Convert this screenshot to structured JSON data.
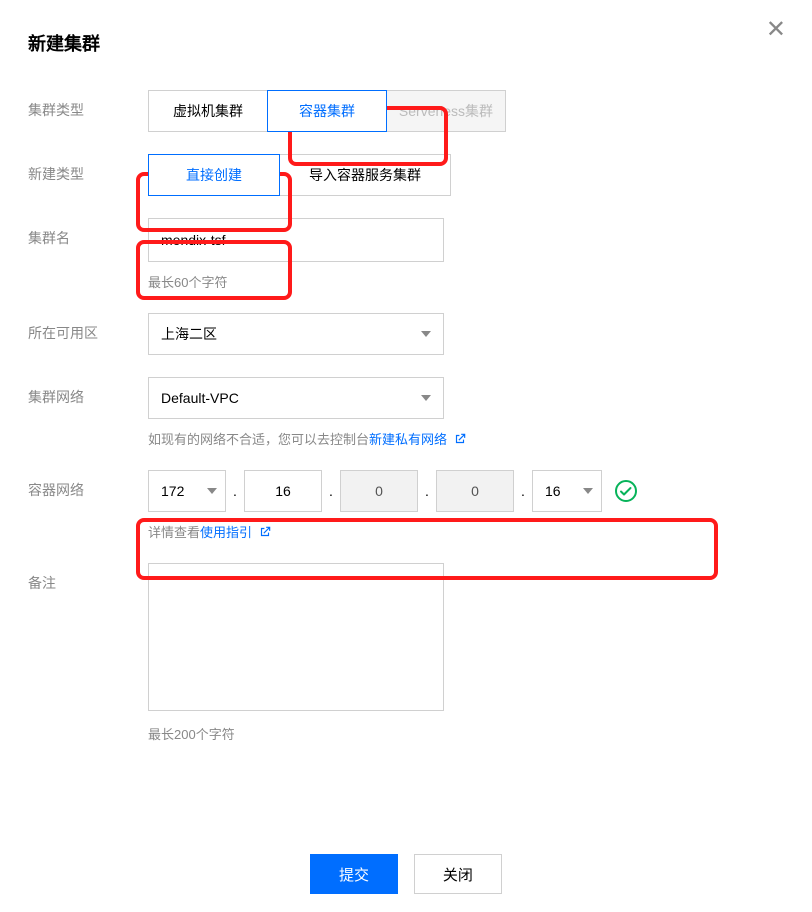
{
  "dialog": {
    "title": "新建集群",
    "submit_label": "提交",
    "close_label": "关闭"
  },
  "fields": {
    "cluster_type_label": "集群类型",
    "cluster_type_options": {
      "vm": "虚拟机集群",
      "container": "容器集群",
      "serverless": "Serverless集群"
    },
    "create_type_label": "新建类型",
    "create_type_options": {
      "direct": "直接创建",
      "import": "导入容器服务集群"
    },
    "cluster_name_label": "集群名",
    "cluster_name_value": "mendix-tsf",
    "cluster_name_hint": "最长60个字符",
    "zone_label": "所在可用区",
    "zone_value": "上海二区",
    "network_label": "集群网络",
    "network_value": "Default-VPC",
    "network_hint_prefix": "如现有的网络不合适，您可以去控制台",
    "network_hint_link": "新建私有网络",
    "container_net_label": "容器网络",
    "ip_a": "172",
    "ip_b": "16",
    "ip_c": "0",
    "ip_d": "0",
    "cidr": "16",
    "container_net_hint_prefix": "详情查看",
    "container_net_hint_link": "使用指引",
    "remark_label": "备注",
    "remark_hint": "最长200个字符"
  }
}
